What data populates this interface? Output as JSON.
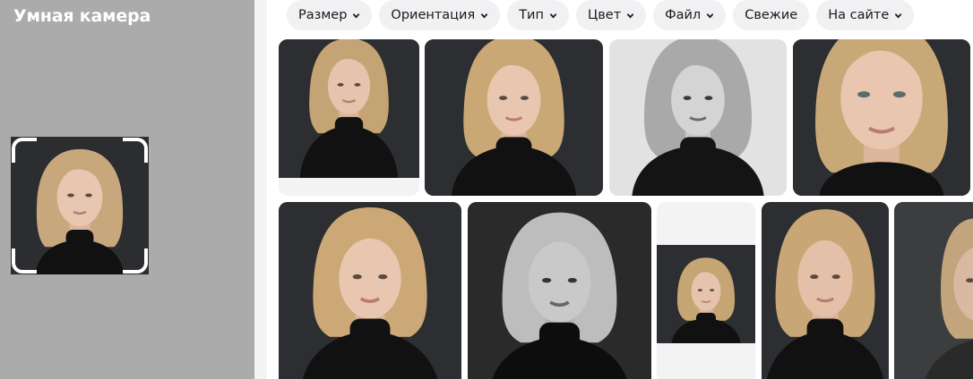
{
  "smart_camera": {
    "title": "Умная камера"
  },
  "filters": [
    {
      "label": "Размер",
      "has_dropdown": true
    },
    {
      "label": "Ориентация",
      "has_dropdown": true
    },
    {
      "label": "Тип",
      "has_dropdown": true
    },
    {
      "label": "Цвет",
      "has_dropdown": true
    },
    {
      "label": "Файл",
      "has_dropdown": true
    },
    {
      "label": "Свежие",
      "has_dropdown": false
    },
    {
      "label": "На сайте",
      "has_dropdown": true
    }
  ],
  "colors": {
    "panel_bg": "#ababab",
    "chip_bg": "#f1f1f3",
    "dark_bg": "#2b2c2f",
    "turtleneck": "#111111",
    "hair_blonde": "#c9a878",
    "skin": "#e6c3ad"
  },
  "results": [
    {
      "id": "result-1",
      "tone": "color"
    },
    {
      "id": "result-2",
      "tone": "color"
    },
    {
      "id": "result-3",
      "tone": "mono-light"
    },
    {
      "id": "result-4",
      "tone": "color"
    },
    {
      "id": "result-5",
      "tone": "color"
    },
    {
      "id": "result-6",
      "tone": "mono-dark"
    },
    {
      "id": "result-7",
      "tone": "color"
    },
    {
      "id": "result-8",
      "tone": "color"
    },
    {
      "id": "result-9",
      "tone": "color"
    }
  ]
}
